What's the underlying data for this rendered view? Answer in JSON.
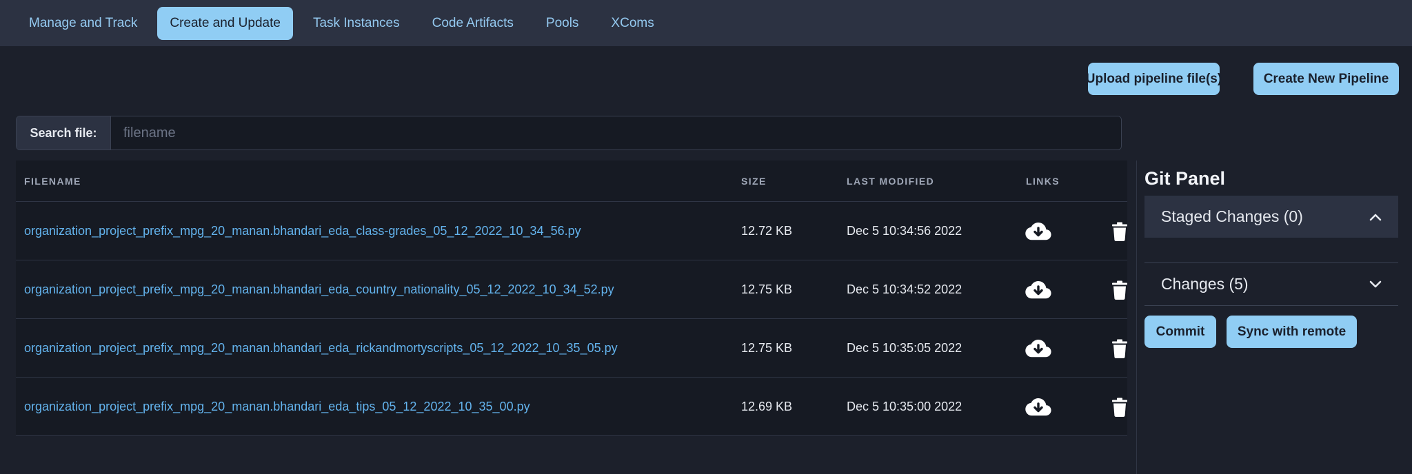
{
  "nav": {
    "tabs": [
      {
        "label": "Manage and Track",
        "active": false
      },
      {
        "label": "Create and Update",
        "active": true
      },
      {
        "label": "Task Instances",
        "active": false
      },
      {
        "label": "Code Artifacts",
        "active": false
      },
      {
        "label": "Pools",
        "active": false
      },
      {
        "label": "XComs",
        "active": false
      }
    ]
  },
  "actions": {
    "upload_label": "Upload pipeline file(s)",
    "create_label": "Create New Pipeline"
  },
  "search": {
    "label": "Search file:",
    "placeholder": "filename",
    "value": ""
  },
  "table": {
    "headers": {
      "filename": "FILENAME",
      "size": "SIZE",
      "modified": "LAST MODIFIED",
      "links": "LINKS"
    },
    "rows": [
      {
        "filename": "organization_project_prefix_mpg_20_manan.bhandari_eda_class-grades_05_12_2022_10_34_56.py",
        "size": "12.72 KB",
        "modified": "Dec 5 10:34:56 2022"
      },
      {
        "filename": "organization_project_prefix_mpg_20_manan.bhandari_eda_country_nationality_05_12_2022_10_34_52.py",
        "size": "12.75 KB",
        "modified": "Dec 5 10:34:52 2022"
      },
      {
        "filename": "organization_project_prefix_mpg_20_manan.bhandari_eda_rickandmortyscripts_05_12_2022_10_35_05.py",
        "size": "12.75 KB",
        "modified": "Dec 5 10:35:05 2022"
      },
      {
        "filename": "organization_project_prefix_mpg_20_manan.bhandari_eda_tips_05_12_2022_10_35_00.py",
        "size": "12.69 KB",
        "modified": "Dec 5 10:35:00 2022"
      }
    ],
    "row_icons": [
      "cloud-download-icon",
      "trash-icon"
    ]
  },
  "git_panel": {
    "title": "Git Panel",
    "staged_label": "Staged Changes (0)",
    "staged_expanded": true,
    "changes_label": "Changes (5)",
    "changes_expanded": false,
    "commit_label": "Commit",
    "sync_label": "Sync with remote"
  },
  "colors": {
    "accent": "#90cdf4",
    "link": "#63b3ed",
    "background": "#1c202b",
    "nav_background": "#2c3242"
  }
}
